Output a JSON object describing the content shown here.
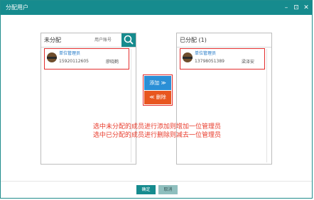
{
  "dialog": {
    "title": "分配用户",
    "minimize_glyph": "–",
    "maximize_glyph": "⊡",
    "close_glyph": "✕"
  },
  "left_panel": {
    "title": "未分配",
    "search_placeholder": "用户账号",
    "item": {
      "role": "单位管理员",
      "phone": "15920112605",
      "name": "廖晓鹤"
    }
  },
  "right_panel": {
    "title": "已分配 (1)",
    "item": {
      "role": "单位管理员",
      "phone": "13798051389",
      "name": "梁泽安"
    }
  },
  "actions": {
    "add_label": "添加 ≫",
    "remove_label": "≪ 删除"
  },
  "annotation": {
    "line1": "选中未分配的成员进行添加则增加一位管理员",
    "line2": "选中已分配的成员进行删除则减去一位管理员"
  },
  "footer": {
    "ok_label": "确定",
    "cancel_label": "取消"
  },
  "colors": {
    "accent": "#168b8e",
    "add_button": "#2b8fd6",
    "remove_button": "#e8561f",
    "annotation": "#e83a2a"
  }
}
